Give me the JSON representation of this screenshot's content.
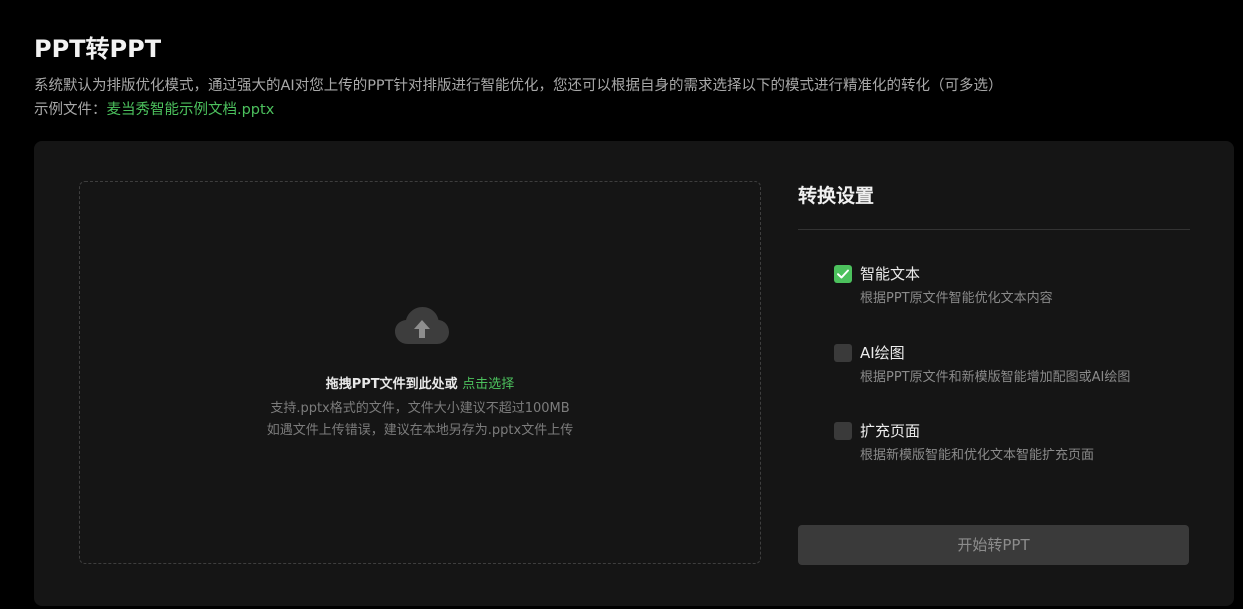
{
  "header": {
    "title": "PPT转PPT",
    "description": "系统默认为排版优化模式，通过强大的AI对您上传的PPT针对排版进行智能优化，您还可以根据自身的需求选择以下的模式进行精准化的转化（可多选）",
    "sample_prefix": "示例文件：",
    "sample_link": "麦当秀智能示例文档.pptx"
  },
  "dropzone": {
    "icon": "cloud-upload-icon",
    "main_text": "拖拽PPT文件到此处或",
    "link_text": "点击选择",
    "hint_1": "支持.pptx格式的文件，文件大小建议不超过100MB",
    "hint_2": "如遇文件上传错误，建议在本地另存为.pptx文件上传"
  },
  "settings": {
    "title": "转换设置",
    "options": [
      {
        "label": "智能文本",
        "description": "根据PPT原文件智能优化文本内容",
        "checked": true
      },
      {
        "label": "AI绘图",
        "description": "根据PPT原文件和新模版智能增加配图或AI绘图",
        "checked": false
      },
      {
        "label": "扩充页面",
        "description": "根据新模版智能和优化文本智能扩充页面",
        "checked": false
      }
    ],
    "start_button": "开始转PPT"
  },
  "colors": {
    "background": "#000000",
    "panel": "#151515",
    "accent": "#4cc15d",
    "button_disabled": "#3a3a3a"
  }
}
